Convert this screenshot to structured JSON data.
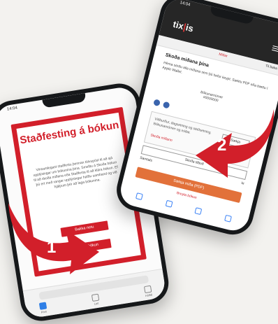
{
  "phone1": {
    "status_time": "14:04",
    "title": "Staðfesting á bókun",
    "body": "Vinsamlegast staðfestu þennan tölvupóst til að sjá upplýsingar um bókunina þína. Smelltu á Skoða bókun til að skoða miðana eða Staðfesta til að klára bókun. Ef þú ert með rangar upplýsingar hafðu samband og við hjálpum þér að laga bókunina.",
    "button_primary": "Bakka netu",
    "button_secondary": "Skoða bókun",
    "tab_labels": [
      "Póst",
      "Leit",
      "Hólfið"
    ]
  },
  "phone2": {
    "status_time": "14:04",
    "logo_text": "tix",
    "logo_suffix": "is",
    "subnav_left": "Miðar",
    "subnav_right": "Til baka",
    "heading": "Skoða miðana þína",
    "paragraph": "Hérna sérðu alla miðana sem þú hefur keypt. Sæktu PDF eða bættu í Apple Wallet.",
    "center_label": "Bókunarnúmer",
    "center_sub": "#0000000",
    "card_text": "Viðburður, dagsetning og staðsetning. Bókunarnúmer og miðar.",
    "card_link": "Skoða miðann",
    "card_button": "Sækja",
    "field_text": "Skoða tilboð",
    "row_left": "Samtals",
    "row_right": "kr",
    "cta_button": "Sækja miða (PDF)",
    "footer_link": "Breyta bókun"
  },
  "arrows": {
    "one_label": "1",
    "two_label": "2",
    "color": "#d21f2a"
  }
}
